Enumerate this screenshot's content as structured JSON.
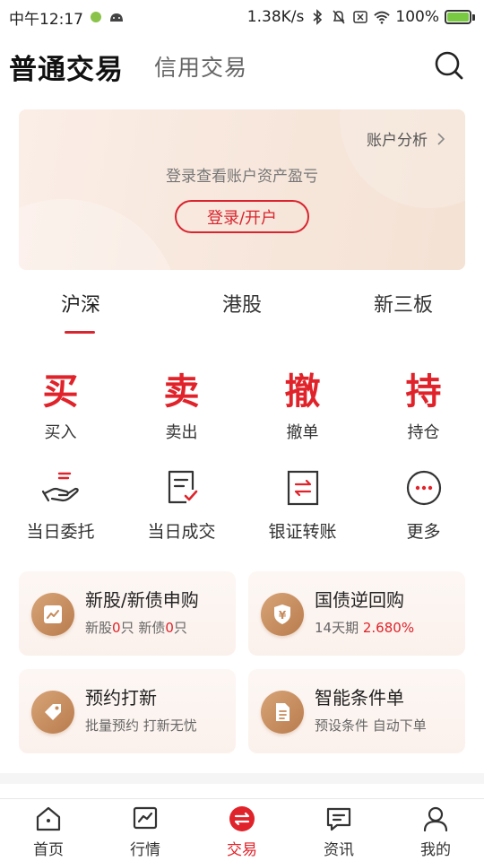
{
  "status_bar": {
    "time": "中午12:17",
    "network_speed": "1.38K/s",
    "battery": "100%"
  },
  "header": {
    "tab_normal": "普通交易",
    "tab_credit": "信用交易"
  },
  "account_card": {
    "analysis_link": "账户分析",
    "login_hint": "登录查看账户资产盈亏",
    "login_button": "登录/开户"
  },
  "market_tabs": [
    {
      "label": "沪深",
      "active": true
    },
    {
      "label": "港股",
      "active": false
    },
    {
      "label": "新三板",
      "active": false
    }
  ],
  "trade_actions": [
    {
      "char": "买",
      "label": "买入"
    },
    {
      "char": "卖",
      "label": "卖出"
    },
    {
      "char": "撤",
      "label": "撤单"
    },
    {
      "char": "持",
      "label": "持仓"
    }
  ],
  "tools": [
    {
      "icon": "hand-order-icon",
      "label": "当日委托"
    },
    {
      "icon": "document-check-icon",
      "label": "当日成交"
    },
    {
      "icon": "transfer-icon",
      "label": "银证转账"
    },
    {
      "icon": "more-icon",
      "label": "更多"
    }
  ],
  "services": {
    "ipo": {
      "title": "新股/新债申购",
      "sub_prefix_stock": "新股",
      "stock_count": "0",
      "sub_unit_1": "只 新债",
      "bond_count": "0",
      "sub_unit_2": "只"
    },
    "repo": {
      "title": "国债逆回购",
      "sub_period": "14天期",
      "rate": "2.680%"
    },
    "reserve": {
      "title": "预约打新",
      "sub": "批量预约 打新无忧"
    },
    "condition": {
      "title": "智能条件单",
      "sub": "预设条件 自动下单"
    }
  },
  "bottom_nav": [
    {
      "label": "首页",
      "icon": "home-icon",
      "active": false
    },
    {
      "label": "行情",
      "icon": "market-chart-icon",
      "active": false
    },
    {
      "label": "交易",
      "icon": "trade-exchange-icon",
      "active": true
    },
    {
      "label": "资讯",
      "icon": "news-chat-icon",
      "active": false
    },
    {
      "label": "我的",
      "icon": "user-icon",
      "active": false
    }
  ],
  "colors": {
    "accent_red": "#e0232a",
    "gold_icon": "#c68a5b"
  }
}
